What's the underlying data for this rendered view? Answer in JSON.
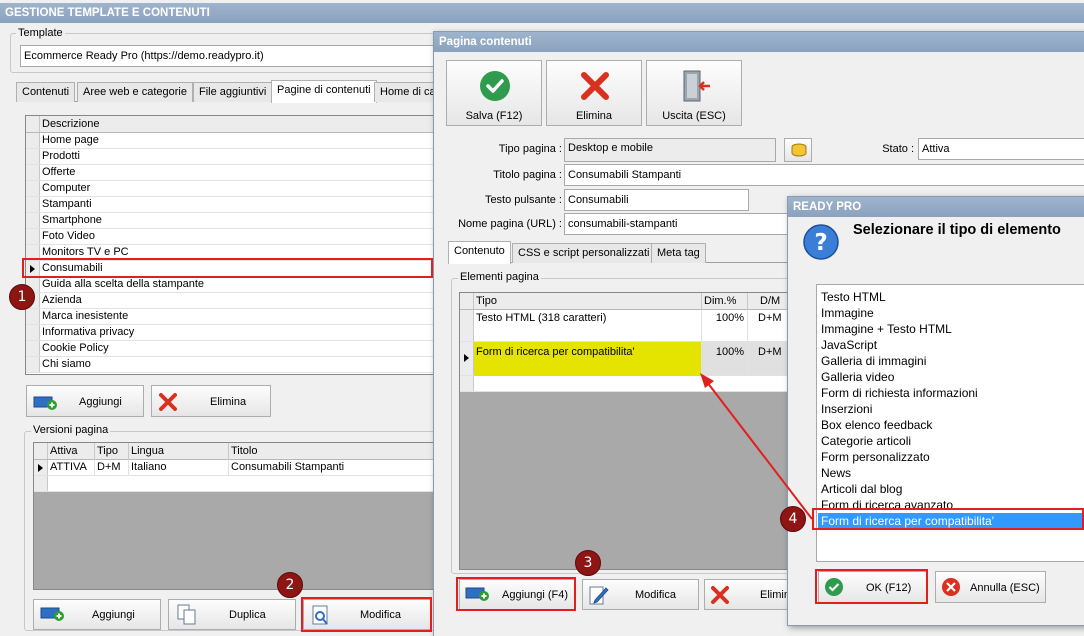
{
  "main_window": {
    "title": "GESTIONE TEMPLATE E CONTENUTI",
    "template_group_label": "Template",
    "template_value": "Ecommerce Ready Pro (https://demo.readypro.it)",
    "tabs": [
      "Contenuti",
      "Aree web e categorie",
      "File aggiuntivi",
      "Pagine di contenuti",
      "Home di ca"
    ],
    "pages_header": "Descrizione",
    "pages": [
      "Home page",
      "Prodotti",
      "Offerte",
      "Computer",
      "Stampanti",
      "Smartphone",
      "Foto Video",
      "Monitors TV e PC",
      "Consumabili",
      "Guida alla scelta della stampante",
      "Azienda",
      "Marca inesistente",
      "Informativa privacy",
      "Cookie Policy",
      "Chi siamo"
    ],
    "add_label": "Aggiungi",
    "delete_label": "Elimina",
    "versions_label": "Versioni pagina",
    "versions_headers": [
      "Attiva",
      "Tipo",
      "Lingua",
      "Titolo"
    ],
    "versions_row": [
      "ATTIVA",
      "D+M",
      "Italiano",
      "Consumabili Stampanti"
    ],
    "versions_add": "Aggiungi",
    "versions_duplicate": "Duplica",
    "versions_modify": "Modifica"
  },
  "content_window": {
    "title": "Pagina contenuti",
    "toolbar": {
      "save": "Salva (F12)",
      "delete": "Elimina",
      "exit": "Uscita (ESC)"
    },
    "tipo_pagina_label": "Tipo pagina :",
    "tipo_pagina_value": "Desktop e mobile",
    "stato_label": "Stato :",
    "stato_value": "Attiva",
    "titolo_label": "Titolo pagina :",
    "titolo_value": "Consumabili Stampanti",
    "pulsante_label": "Testo pulsante :",
    "pulsante_value": "Consumabili",
    "url_label": "Nome pagina (URL) :",
    "url_value": "consumabili-stampanti",
    "tabs": [
      "Contenuto",
      "CSS e script personalizzati",
      "Meta tag"
    ],
    "elements_label": "Elementi pagina",
    "elements_headers": [
      "Tipo",
      "Dim.%",
      "D/M"
    ],
    "elements_rows": [
      {
        "tipo": "Testo HTML (318 caratteri)",
        "dim": "100%",
        "dm": "D+M"
      },
      {
        "tipo": "Form di ricerca per compatibilita'",
        "dim": "100%",
        "dm": "D+M"
      }
    ],
    "add_label": "Aggiungi (F4)",
    "modify_label": "Modifica",
    "delete_label": "Elimin"
  },
  "dialog": {
    "title": "READY PRO",
    "heading": "Selezionare il tipo di elemento",
    "items": [
      "Testo HTML",
      "Immagine",
      "Immagine + Testo HTML",
      "JavaScript",
      "Galleria di immagini",
      "Galleria video",
      "Form di richiesta informazioni",
      "Inserzioni",
      "Box elenco feedback",
      "Categorie articoli",
      "Form personalizzato",
      "News",
      "Articoli dal blog",
      "Form di ricerca avanzato",
      "Form di ricerca per compatibilita'"
    ],
    "ok_label": "OK (F12)",
    "cancel_label": "Annulla (ESC)"
  },
  "badges": [
    "1",
    "2",
    "3",
    "4"
  ],
  "colors": {
    "highlight": "#e21f1f",
    "badge": "#8f1414",
    "selected": "#3399ff",
    "yellow": "#e4e400"
  }
}
